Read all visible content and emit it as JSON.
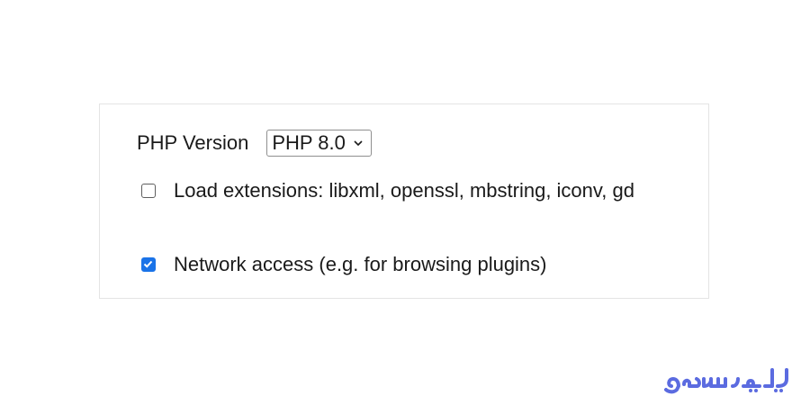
{
  "settings": {
    "php_version_label": "PHP Version",
    "php_version_selected": "PHP 8.0",
    "load_extensions_label": "Load extensions: libxml, openssl, mbstring, iconv, gd",
    "load_extensions_checked": false,
    "network_access_label": "Network access (e.g. for browsing plugins)",
    "network_access_checked": true
  },
  "branding": {
    "logo_text": "ایران سرور",
    "logo_color": "#5b6be0"
  },
  "colors": {
    "checkbox_checked": "#1a73e8",
    "panel_border": "#e4e4e4"
  },
  "icons": {
    "select_arrow": "chevron-down-icon",
    "checkbox_mark": "checkmark-icon"
  }
}
